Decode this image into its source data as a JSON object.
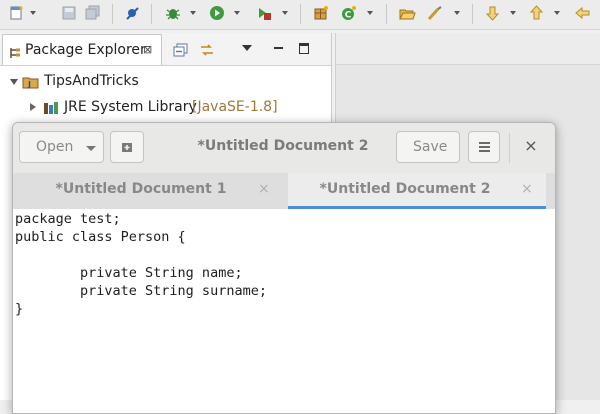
{
  "toolbar": {
    "icons": [
      "new-wizard-icon",
      "save-icon",
      "save-all-icon",
      "skip-breakpoints-icon",
      "debug-icon",
      "run-icon",
      "external-tools-icon",
      "new-java-package-icon",
      "new-class-icon",
      "open-type-icon",
      "search-icon",
      "next-annotation-icon",
      "previous-annotation-icon",
      "back-icon"
    ]
  },
  "package_explorer": {
    "tab_label": "Package Explorer",
    "close_glyph": "⊠",
    "tree": {
      "project": "TipsAndTricks",
      "library": "JRE System Library",
      "library_version": "[JavaSE-1.8]"
    }
  },
  "gedit": {
    "title": "*Untitled Document 2",
    "open_label": "Open",
    "save_label": "Save",
    "close_glyph": "×",
    "tabs": [
      {
        "label": "*Untitled Document 1",
        "close": "×"
      },
      {
        "label": "*Untitled Document 2",
        "close": "×"
      }
    ],
    "code": [
      "package test;",
      "public class Person {",
      "",
      "        private String name;",
      "        private String surname;",
      "}"
    ]
  },
  "colors": {
    "active_tab_underline": "#4a90d9",
    "library_version_text": "#a0773a"
  }
}
